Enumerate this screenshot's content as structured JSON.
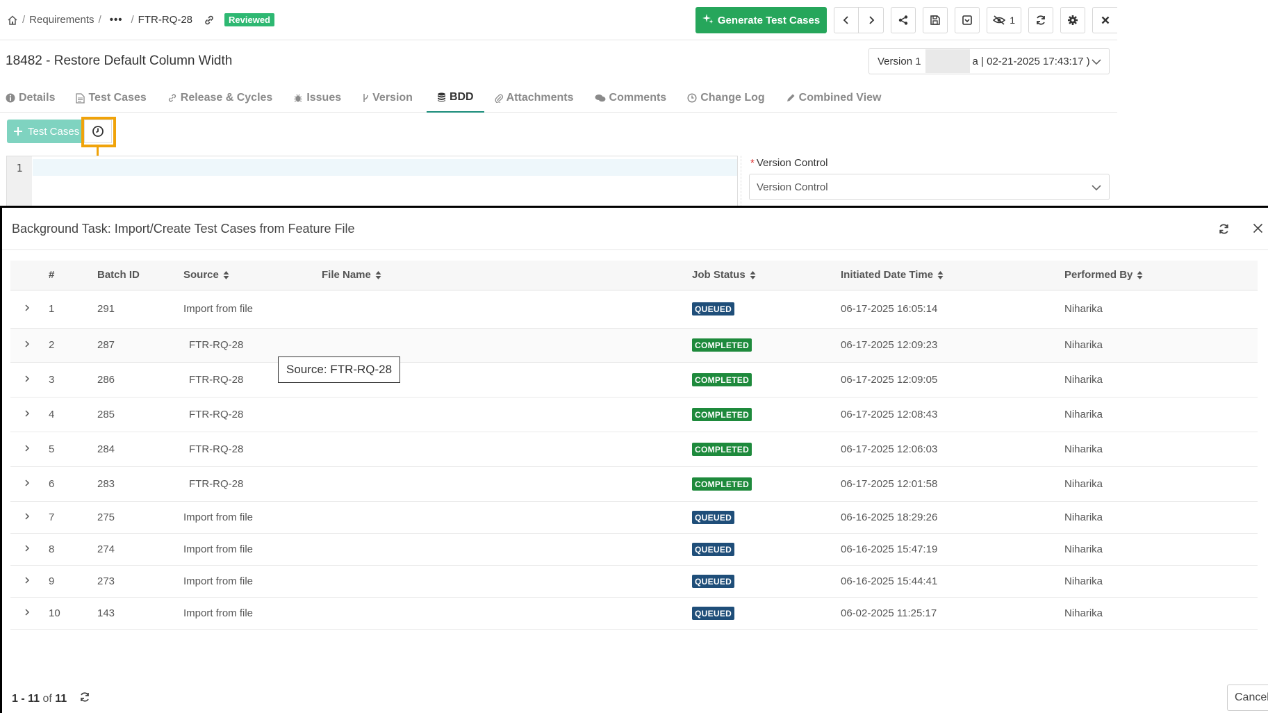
{
  "breadcrumb": {
    "requirements": "Requirements",
    "ellipsis": "•••",
    "code": "FTR-RQ-28",
    "status_badge": "Reviewed"
  },
  "toolbar": {
    "generate_label": "Generate Test Cases",
    "watch_count": "1"
  },
  "page": {
    "title": "18482 - Restore Default Column Width",
    "version_prefix": "Version 1",
    "version_suffix": "a | 02-21-2025 17:43:17 )"
  },
  "tabs": [
    {
      "label": "Details",
      "icon": "info-circle-icon"
    },
    {
      "label": "Test Cases",
      "icon": "document-icon"
    },
    {
      "label": "Release & Cycles",
      "icon": "link-icon"
    },
    {
      "label": "Issues",
      "icon": "bug-icon"
    },
    {
      "label": "Version",
      "icon": "branch-icon"
    },
    {
      "label": "BDD",
      "icon": "database-icon",
      "active": true
    },
    {
      "label": "Attachments",
      "icon": "paperclip-icon"
    },
    {
      "label": "Comments",
      "icon": "comments-icon"
    },
    {
      "label": "Change Log",
      "icon": "clock-icon"
    },
    {
      "label": "Combined View",
      "icon": "pencil-icon"
    }
  ],
  "bdd": {
    "add_test_cases_label": "Test Cases",
    "line_number": "1",
    "version_control_label": "Version Control",
    "version_control_placeholder": "Version Control"
  },
  "panel": {
    "title": "Background Task: Import/Create Test Cases from Feature File",
    "columns": [
      "#",
      "Batch ID",
      "Source",
      "File Name",
      "Job Status",
      "Initiated Date Time",
      "Performed By"
    ],
    "rows": [
      {
        "num": "1",
        "batch": "291",
        "source": "Import from file",
        "file": "",
        "status": "QUEUED",
        "date": "06-17-2025 16:05:14",
        "by": "Niharika"
      },
      {
        "num": "2",
        "batch": "287",
        "source": "FTR-RQ-28",
        "file": "",
        "status": "COMPLETED",
        "date": "06-17-2025 12:09:23",
        "by": "Niharika"
      },
      {
        "num": "3",
        "batch": "286",
        "source": "FTR-RQ-28",
        "file": "",
        "status": "COMPLETED",
        "date": "06-17-2025 12:09:05",
        "by": "Niharika"
      },
      {
        "num": "4",
        "batch": "285",
        "source": "FTR-RQ-28",
        "file": "",
        "status": "COMPLETED",
        "date": "06-17-2025 12:08:43",
        "by": "Niharika"
      },
      {
        "num": "5",
        "batch": "284",
        "source": "FTR-RQ-28",
        "file": "",
        "status": "COMPLETED",
        "date": "06-17-2025 12:06:03",
        "by": "Niharika"
      },
      {
        "num": "6",
        "batch": "283",
        "source": "FTR-RQ-28",
        "file": "",
        "status": "COMPLETED",
        "date": "06-17-2025 12:01:58",
        "by": "Niharika"
      },
      {
        "num": "7",
        "batch": "275",
        "source": "Import from file",
        "file": "",
        "status": "QUEUED",
        "date": "06-16-2025 18:29:26",
        "by": "Niharika"
      },
      {
        "num": "8",
        "batch": "274",
        "source": "Import from file",
        "file": "",
        "status": "QUEUED",
        "date": "06-16-2025 15:47:19",
        "by": "Niharika"
      },
      {
        "num": "9",
        "batch": "273",
        "source": "Import from file",
        "file": "",
        "status": "QUEUED",
        "date": "06-16-2025 15:44:41",
        "by": "Niharika"
      },
      {
        "num": "10",
        "batch": "143",
        "source": "Import from file",
        "file": "",
        "status": "QUEUED",
        "date": "06-02-2025 11:25:17",
        "by": "Niharika"
      }
    ],
    "tooltip": "Source: FTR-RQ-28",
    "pager_range": "1 - 11",
    "pager_of": "of",
    "pager_total": "11",
    "cancel_label": "Cancel"
  },
  "colors": {
    "accent_green": "#26a65b",
    "badge_green": "#2eb872",
    "status_queued": "#1f4e79",
    "status_completed": "#1e8a3c",
    "highlight": "#f0a30a"
  }
}
